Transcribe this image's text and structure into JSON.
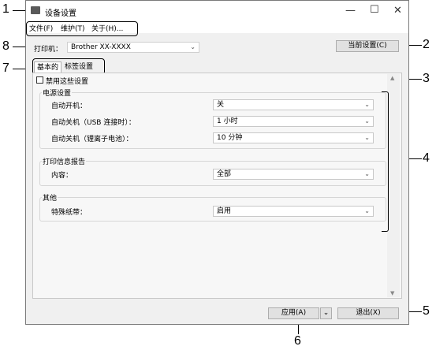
{
  "window": {
    "title": "设备设置",
    "minimize_glyph": "—",
    "maximize_glyph": "☐",
    "close_glyph": "✕"
  },
  "menu": {
    "items": [
      "文件(F)",
      "维护(T)",
      "关于(H)..."
    ]
  },
  "printer": {
    "label": "打印机：",
    "value": "Brother  XX-XXXX"
  },
  "current_settings_button": "当前设置(C)",
  "tabs": [
    "基本的",
    "标签设置"
  ],
  "disable_settings_label": "禁用这些设置",
  "groups": {
    "power": {
      "title": "电源设置",
      "rows": [
        {
          "label": "自动开机：",
          "value": "关"
        },
        {
          "label": "自动关机（USB 连接时）：",
          "value": "1 小时"
        },
        {
          "label": "自动关机（锂离子电池）：",
          "value": "10 分钟"
        }
      ]
    },
    "report": {
      "title": "打印信息报告",
      "rows": [
        {
          "label": "内容：",
          "value": "全部"
        }
      ]
    },
    "other": {
      "title": "其他",
      "rows": [
        {
          "label": "特殊纸带：",
          "value": "启用"
        }
      ]
    }
  },
  "footer": {
    "apply_button": "应用(A)",
    "apply_dropdown_glyph": "⌄",
    "exit_button": "退出(X)"
  },
  "callouts": [
    "1",
    "2",
    "3",
    "4",
    "5",
    "6",
    "7",
    "8"
  ]
}
